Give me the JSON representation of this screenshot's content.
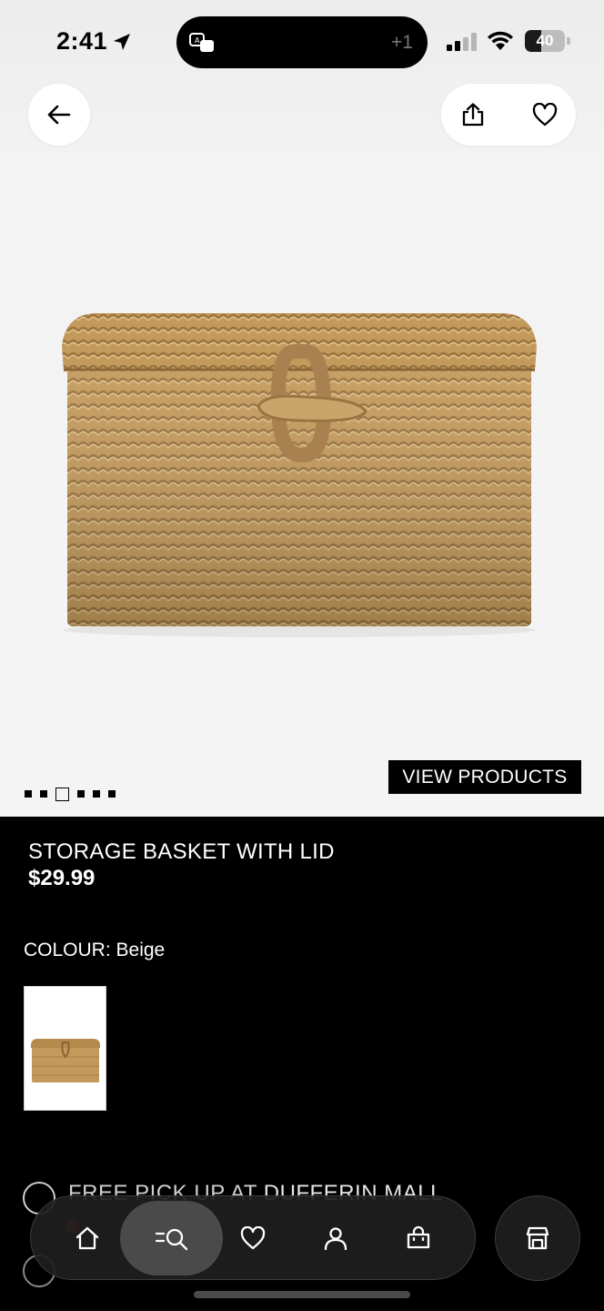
{
  "status_bar": {
    "time": "2:41",
    "island_extra": "+1",
    "battery_percent": "40",
    "battery_level": 0.4
  },
  "header": {
    "back_icon": "arrow-left-icon",
    "share_icon": "share-icon",
    "favorite_icon": "heart-icon"
  },
  "gallery": {
    "image_count": 6,
    "active_index": 2,
    "view_products_label": "VIEW PRODUCTS"
  },
  "product": {
    "name": "STORAGE BASKET WITH LID",
    "price": "$29.99",
    "colour_label": "COLOUR: Beige"
  },
  "pickup": {
    "label_prefix": "FREE PICK UP AT",
    "store_name": "DUFFERIN MALL"
  },
  "tab_bar": {
    "items": [
      {
        "icon": "home-icon"
      },
      {
        "icon": "search-icon"
      },
      {
        "icon": "heart-icon"
      },
      {
        "icon": "account-icon"
      },
      {
        "icon": "bag-icon"
      }
    ],
    "active": 1,
    "store_icon": "store-icon"
  },
  "colors": {
    "background": "#000000",
    "hero": "#f4f4f4",
    "basket": "#c9a56b"
  }
}
